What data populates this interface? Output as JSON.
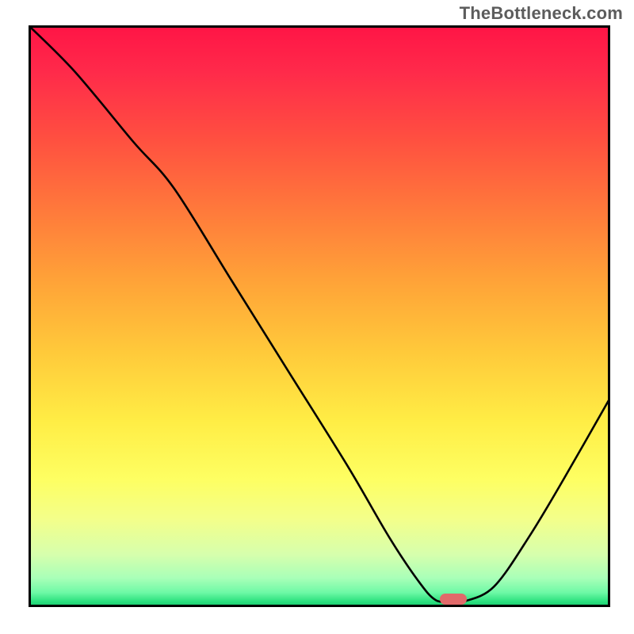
{
  "watermark": "TheBottleneck.com",
  "chart_data": {
    "type": "line",
    "title": "",
    "xlabel": "",
    "ylabel": "",
    "xlim": [
      0,
      100
    ],
    "ylim": [
      0,
      100
    ],
    "x": [
      0,
      8,
      18,
      25,
      35,
      45,
      55,
      62,
      67,
      70,
      73,
      75,
      80,
      86,
      92,
      100
    ],
    "values": [
      100,
      92,
      80,
      72,
      56,
      40,
      24,
      12,
      4.5,
      1.2,
      1.0,
      1.0,
      3.5,
      12,
      22,
      36
    ],
    "marker": {
      "x": 73,
      "y": 1.3
    },
    "background": "vertical-gradient red→orange→yellow→green",
    "curve_color": "#000000",
    "grid": false
  }
}
